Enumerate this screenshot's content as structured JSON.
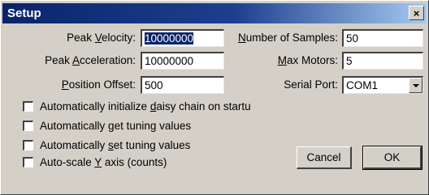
{
  "window": {
    "title": "Setup",
    "close_glyph": "×"
  },
  "fields": {
    "peak_velocity": {
      "label_pre": "Peak ",
      "label_key": "V",
      "label_post": "elocity:",
      "value": "10000000"
    },
    "peak_acceleration": {
      "label_pre": "Peak ",
      "label_key": "A",
      "label_post": "cceleration:",
      "value": "10000000"
    },
    "position_offset": {
      "label_pre": "",
      "label_key": "P",
      "label_post": "osition Offset:",
      "value": "500"
    },
    "number_of_samples": {
      "label_pre": "",
      "label_key": "N",
      "label_post": "umber of Samples:",
      "value": "50"
    },
    "max_motors": {
      "label_pre": "",
      "label_key": "M",
      "label_post": "ax Motors:",
      "value": "5"
    },
    "serial_port": {
      "label": "Serial Port:",
      "value": "COM1"
    }
  },
  "checkboxes": [
    {
      "pre": "Automatically initialize ",
      "key": "d",
      "post": "aisy chain on startu",
      "checked": false
    },
    {
      "pre": "Automatically ",
      "key": "g",
      "post": "et tuning values",
      "checked": false
    },
    {
      "pre": "Automatically ",
      "key": "s",
      "post": "et tuning values",
      "checked": false
    },
    {
      "pre": "Auto-scale ",
      "key": "Y",
      "post": " axis (counts)",
      "checked": false
    }
  ],
  "buttons": {
    "cancel": "Cancel",
    "ok": "OK"
  }
}
